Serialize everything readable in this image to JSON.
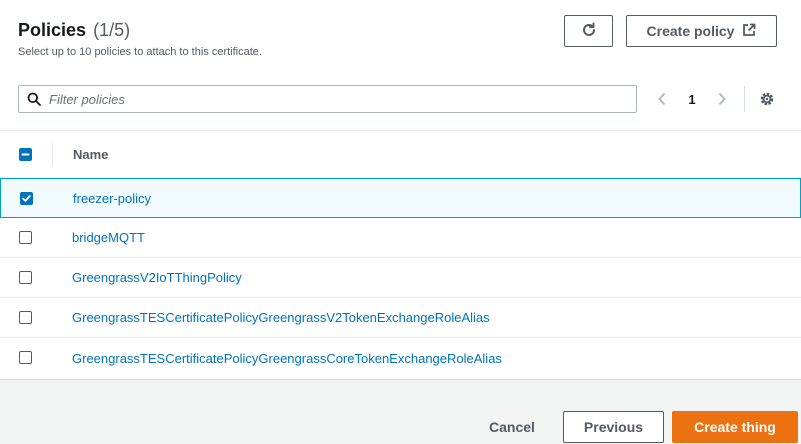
{
  "header": {
    "title": "Policies",
    "count": "(1/5)",
    "subtitle": "Select up to 10 policies to attach to this certificate."
  },
  "toolbar": {
    "refresh_icon": "refresh-icon",
    "create_policy_label": "Create policy",
    "external_icon": "external-link-icon"
  },
  "search": {
    "placeholder": "Filter policies",
    "value": ""
  },
  "pagination": {
    "current_page": "1"
  },
  "table": {
    "columns": [
      "Name"
    ],
    "header_checkbox_state": "indeterminate",
    "rows": [
      {
        "name": "freezer-policy",
        "checked": true
      },
      {
        "name": "bridgeMQTT",
        "checked": false
      },
      {
        "name": "GreengrassV2IoTThingPolicy",
        "checked": false
      },
      {
        "name": "GreengrassTESCertificatePolicyGreengrassV2TokenExchangeRoleAlias",
        "checked": false
      },
      {
        "name": "GreengrassTESCertificatePolicyGreengrassCoreTokenExchangeRoleAlias",
        "checked": false
      }
    ]
  },
  "footer": {
    "cancel_label": "Cancel",
    "previous_label": "Previous",
    "create_thing_label": "Create thing"
  },
  "colors": {
    "primary": "#ec7211",
    "link": "#0073bb",
    "selected_border": "#00a1c9"
  }
}
